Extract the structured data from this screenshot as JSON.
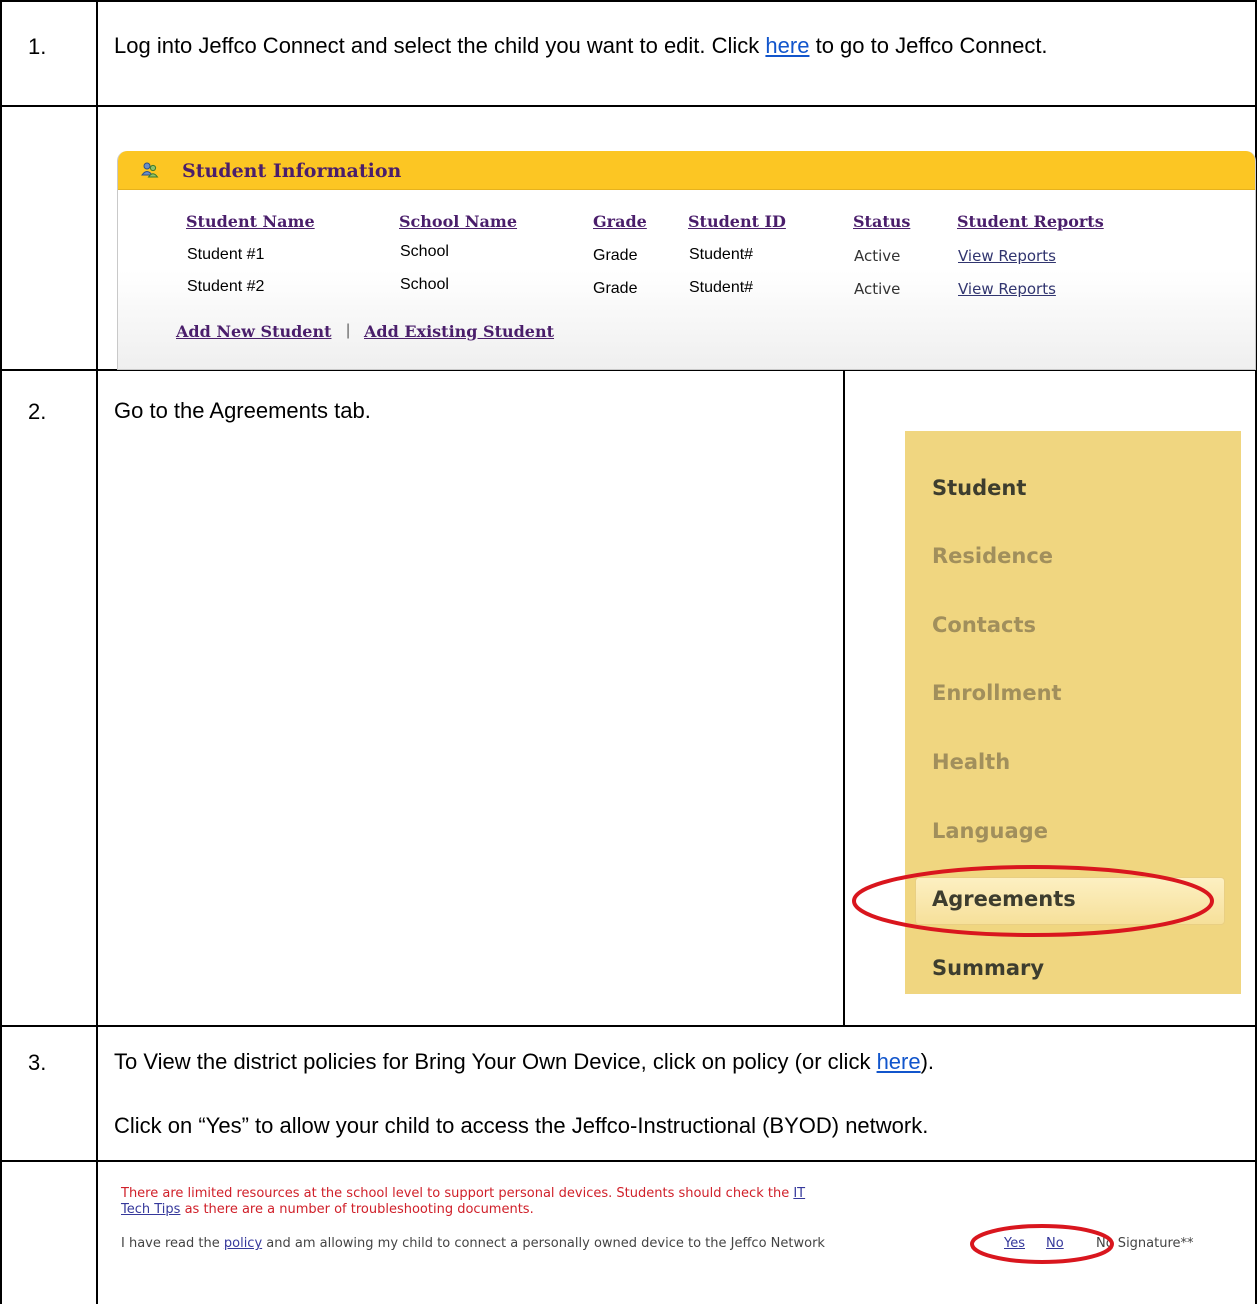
{
  "rows": [
    {
      "number": "1.",
      "text_before": "Log into Jeffco Connect and select the child you want to edit. Click ",
      "link": "here",
      "text_after": " to go to Jeffco Connect."
    },
    {
      "number": "2.",
      "text": "Go to the Agreements tab."
    },
    {
      "number": "3.",
      "line1_before": "To View the district policies for Bring Your Own Device, click on policy (or click ",
      "line1_link": "here",
      "line1_after": ").",
      "line2": "Click on “Yes” to allow your child to access the Jeffco-Instructional (BYOD) network."
    }
  ],
  "student_panel": {
    "title": "Student Information",
    "headers": [
      "Student Name",
      "School Name",
      "Grade",
      "Student ID",
      "Status",
      "Student Reports"
    ],
    "rows": [
      [
        "Student #1",
        "School",
        "Grade",
        "Student#",
        "Active",
        "View Reports"
      ],
      [
        "Student #2",
        "School",
        "Grade",
        "Student#",
        "Active",
        "View Reports"
      ]
    ],
    "add_new": "Add New Student",
    "separator": "|",
    "add_existing": "Add Existing Student"
  },
  "menu": {
    "items": [
      "Student",
      "Residence",
      "Contacts",
      "Enrollment",
      "Health",
      "Language",
      "Agreements",
      "Summary"
    ],
    "highlighted": "Agreements"
  },
  "policy": {
    "notice_before": "There are limited resources at the school level to support personal devices. Students should check the ",
    "notice_link_1": "IT",
    "notice_link_2": "Tech Tips",
    "notice_after": " as there are a number of troubleshooting documents.",
    "statement_before": "I have read the ",
    "statement_link": "policy",
    "statement_after": " and am allowing my child to connect a personally owned device to the Jeffco Network",
    "yes": "Yes",
    "no": "No",
    "no_signature": "No Signature**"
  },
  "colors": {
    "panel_header": "#fcc623",
    "panel_title": "#4a1e6b",
    "menu_bg": "#f0d680",
    "annotation_ring": "#d9161e",
    "link": "#1155cc"
  }
}
